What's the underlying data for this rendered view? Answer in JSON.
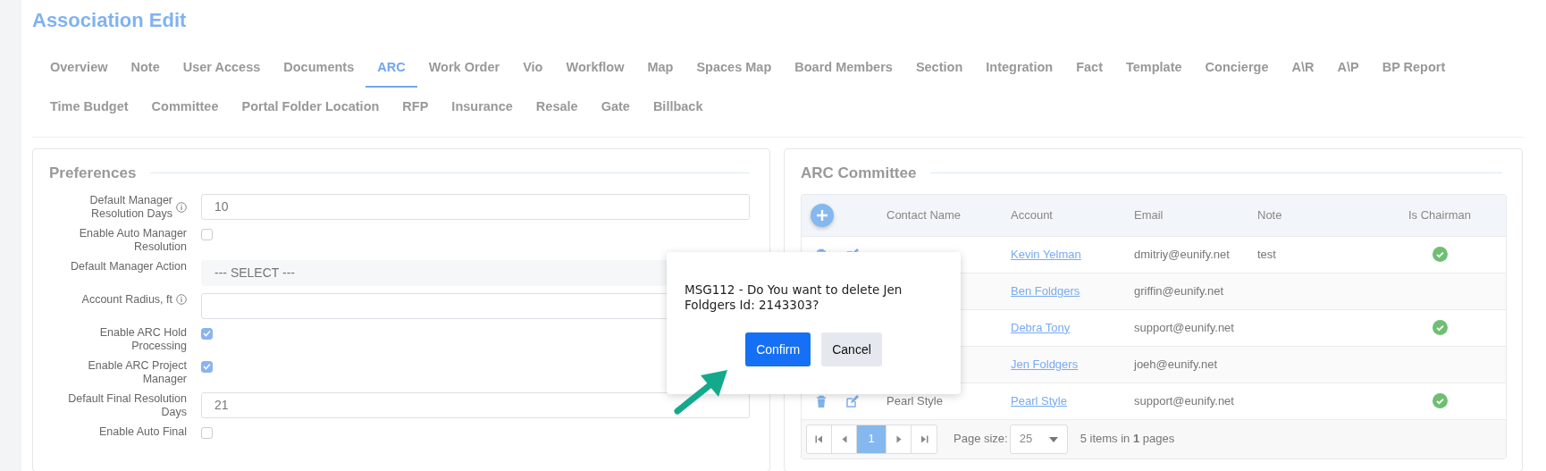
{
  "page": {
    "title": "Association Edit"
  },
  "tab_rows": [
    [
      {
        "label": "Overview",
        "selected": false
      },
      {
        "label": "Note",
        "selected": false
      },
      {
        "label": "User Access",
        "selected": false
      },
      {
        "label": "Documents",
        "selected": false
      },
      {
        "label": "ARC",
        "selected": true
      },
      {
        "label": "Work Order",
        "selected": false
      },
      {
        "label": "Vio",
        "selected": false
      },
      {
        "label": "Workflow",
        "selected": false
      },
      {
        "label": "Map",
        "selected": false
      },
      {
        "label": "Spaces Map",
        "selected": false
      },
      {
        "label": "Board Members",
        "selected": false
      },
      {
        "label": "Section",
        "selected": false
      },
      {
        "label": "Integration",
        "selected": false
      },
      {
        "label": "Fact",
        "selected": false
      },
      {
        "label": "Template",
        "selected": false
      },
      {
        "label": "Concierge",
        "selected": false
      },
      {
        "label": "A\\R",
        "selected": false
      },
      {
        "label": "A\\P",
        "selected": false
      },
      {
        "label": "BP Report",
        "selected": false
      }
    ],
    [
      {
        "label": "Time Budget",
        "selected": false
      },
      {
        "label": "Committee",
        "selected": false
      },
      {
        "label": "Portal Folder Location",
        "selected": false
      },
      {
        "label": "RFP",
        "selected": false
      },
      {
        "label": "Insurance",
        "selected": false
      },
      {
        "label": "Resale",
        "selected": false
      },
      {
        "label": "Gate",
        "selected": false
      },
      {
        "label": "Billback",
        "selected": false
      }
    ]
  ],
  "preferences": {
    "title": "Preferences",
    "fields": [
      {
        "kind": "input",
        "label": "Default Manager Resolution Days",
        "info": true,
        "value": "10"
      },
      {
        "kind": "checkbox",
        "label": "Enable Auto Manager Resolution",
        "info": false,
        "checked": false
      },
      {
        "kind": "select",
        "label": "Default Manager Action",
        "info": false,
        "placeholder": "--- SELECT ---"
      },
      {
        "kind": "input",
        "label": "Account Radius, ft",
        "info": true
      },
      {
        "kind": "checkbox",
        "label": "Enable ARC Hold Processing",
        "info": false,
        "checked": true
      },
      {
        "kind": "checkbox",
        "label": "Enable ARC Project Manager",
        "info": false,
        "checked": true
      },
      {
        "kind": "input",
        "label": "Default Final Resolution Days",
        "info": false,
        "value": "21"
      },
      {
        "kind": "checkbox",
        "label": "Enable Auto Final",
        "info": false,
        "checked": false
      }
    ]
  },
  "committee": {
    "title": "ARC Committee",
    "columns": [
      "Contact Name",
      "Account",
      "Email",
      "Note",
      "Is Chairman"
    ],
    "rows": [
      {
        "actions": [
          {
            "kind": "delete"
          },
          {
            "kind": "edit"
          }
        ],
        "account": "Kevin Yelman",
        "email": "dmitriy@eunify.net",
        "note": "test",
        "is_chairman": true
      },
      {
        "account": "Ben Foldgers",
        "email": "griffin@eunify.net",
        "is_chairman": false
      },
      {
        "account": "Debra Tony",
        "email": "support@eunify.net",
        "is_chairman": true
      },
      {
        "account": "Jen Foldgers",
        "email": "joeh@eunify.net",
        "is_chairman": false
      },
      {
        "actions": [
          {
            "kind": "delete"
          },
          {
            "kind": "edit"
          }
        ],
        "contact_name": "Pearl Style",
        "account": "Pearl Style",
        "email": "support@eunify.net",
        "is_chairman": true
      }
    ],
    "pager": {
      "pages": [
        {
          "label": "1",
          "selected": true
        }
      ],
      "page_size_label": "Page size:",
      "page_size": "25",
      "summary": "5 items in **1** pages"
    }
  },
  "dialog": {
    "message": "MSG112 - Do You want to delete Jen Foldgers Id: 2143303?",
    "buttons": [
      {
        "label": "Confirm",
        "kind": "primary"
      },
      {
        "label": "Cancel",
        "kind": "secondary"
      }
    ]
  }
}
